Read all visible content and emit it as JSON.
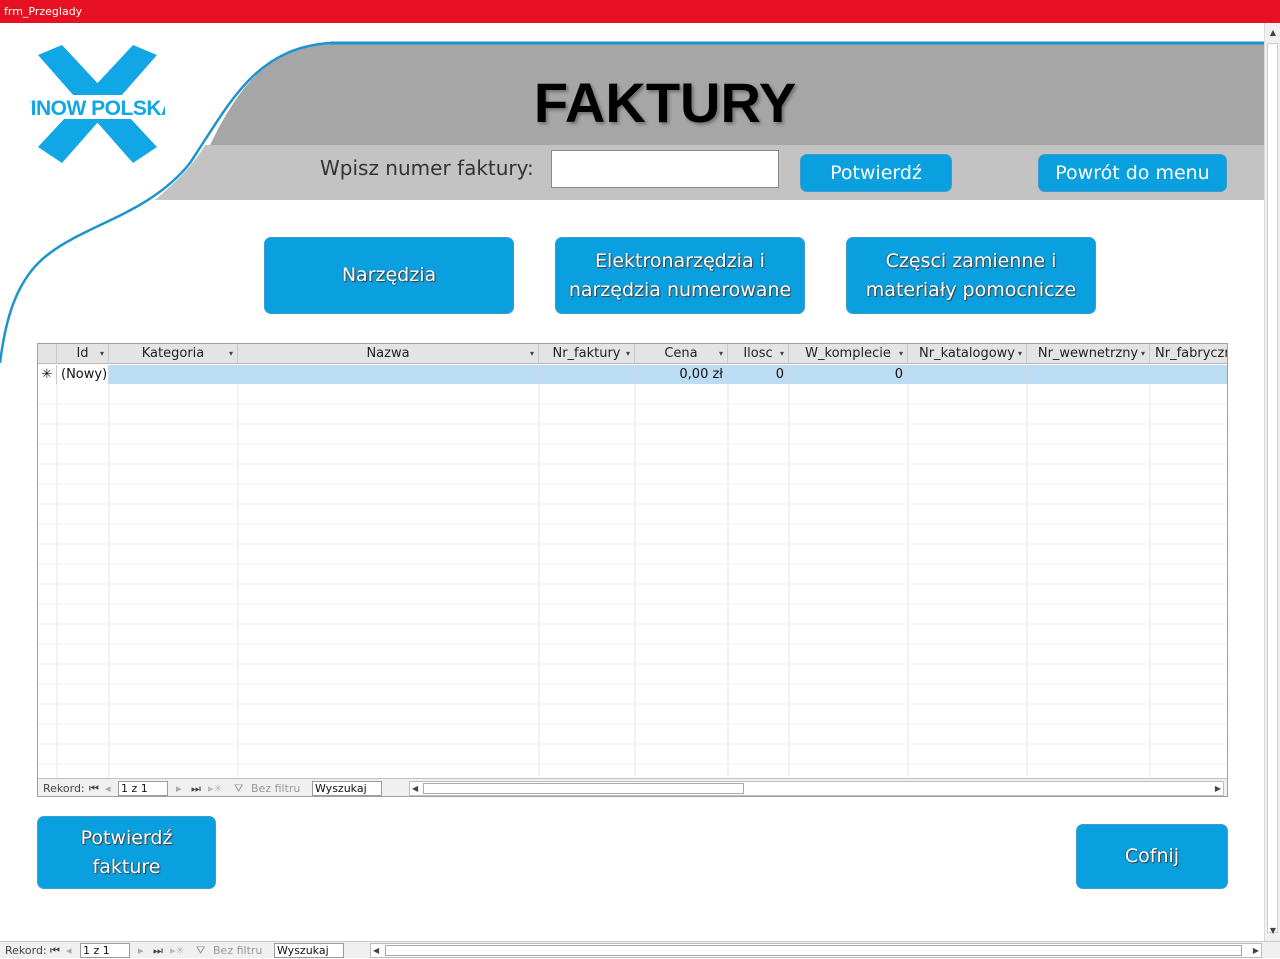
{
  "window": {
    "title": "frm_Przeglady"
  },
  "brand": {
    "logo_text": "FINOW POLSKA",
    "color": "#11a6e6"
  },
  "header": {
    "title": "FAKTURY",
    "search_label": "Wpisz numer faktury:",
    "search_value": "",
    "confirm_label": "Potwierdź",
    "menu_label": "Powrót do menu"
  },
  "categories": {
    "tools_label": "Narzędzia",
    "electro_label": "Elektronarzędzia i\nnarzędzia numerowane",
    "parts_label": "Częsci zamienne i\nmateriały pomocnicze"
  },
  "datasheet": {
    "columns": [
      "Id",
      "Kategoria",
      "Nazwa",
      "Nr_faktury",
      "Cena",
      "Ilosc",
      "W_komplecie",
      "Nr_katalogowy",
      "Nr_wewnetrzny",
      "Nr_fabryczn"
    ],
    "new_row": {
      "marker": "✳",
      "id": "(Nowy)",
      "kategoria": "",
      "nazwa": "",
      "nr_faktury": "",
      "cena": "0,00 zł",
      "ilosc": "0",
      "w_komplecie": "0",
      "nr_katalogowy": "",
      "nr_wewnetrzny": "",
      "nr_fabryczny": ""
    },
    "nav": {
      "record_label": "Rekord:",
      "position": "1 z 1",
      "filter_label": "Bez filtru",
      "search_placeholder": "Wyszukaj"
    }
  },
  "actions": {
    "confirm_invoice_label": "Potwierdź\nfakture",
    "back_label": "Cofnij"
  },
  "form_nav": {
    "record_label": "Rekord:",
    "position": "1 z 1",
    "filter_label": "Bez filtru",
    "search_placeholder": "Wyszukaj"
  },
  "colors": {
    "title_bar": "#e81123",
    "button": "#0aa0e0",
    "header_band": "#a6a6a6",
    "search_band": "#c3c3c3",
    "selected_row": "#bcdcf4"
  }
}
